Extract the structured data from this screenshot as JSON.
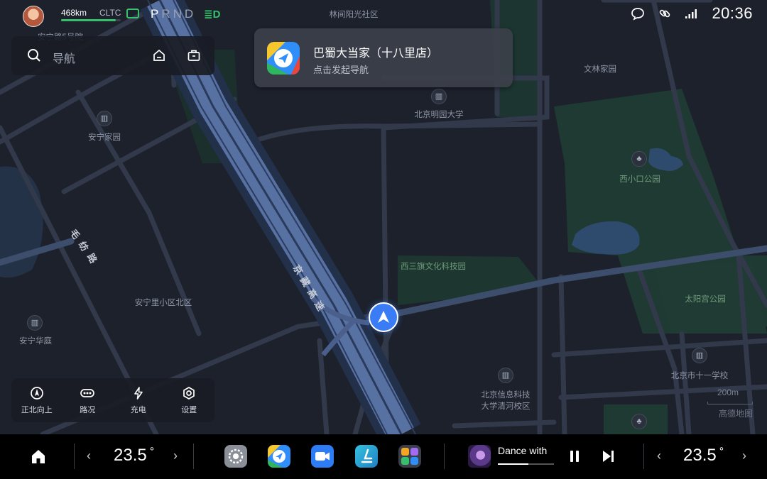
{
  "status": {
    "range": "468km",
    "range_standard": "CLTC",
    "range_level_percent": 92,
    "gear": {
      "letters": [
        "P",
        "R",
        "N",
        "D"
      ],
      "active": "P"
    },
    "headlight_icon": "≣D",
    "time": "20:36"
  },
  "search": {
    "placeholder": "导航"
  },
  "destination": {
    "name": "巴蜀大当家（十八里店）",
    "action": "点击发起导航"
  },
  "map": {
    "labels": [
      {
        "id": "a",
        "text": "林间阳光社区",
        "green": false
      },
      {
        "id": "b",
        "text": "安宁路5号院",
        "green": false
      },
      {
        "id": "c",
        "text": "文林家园",
        "green": false
      },
      {
        "id": "d",
        "text": "北京明园大学",
        "green": false
      },
      {
        "id": "e",
        "text": "安宁家园",
        "green": false
      },
      {
        "id": "f",
        "text": "西小口公园",
        "green": true
      },
      {
        "id": "g",
        "text": "西三旗文化科技园",
        "green": true
      },
      {
        "id": "h",
        "text": "太阳宫公园",
        "green": true
      },
      {
        "id": "i",
        "text": "安宁里小区北区",
        "green": false
      },
      {
        "id": "j",
        "text": "安宁华庭",
        "green": false
      },
      {
        "id": "k",
        "text": "北京市十一学校",
        "green": false
      },
      {
        "id": "l",
        "text": "北京信息科技",
        "green": false
      },
      {
        "id": "m",
        "text": "大学清河校区",
        "green": false
      }
    ],
    "road_names": [
      {
        "id": "r1",
        "chars": [
          "毛",
          "纺",
          "路"
        ]
      },
      {
        "id": "r2",
        "chars": [
          "京",
          "藏",
          "高",
          "速"
        ]
      }
    ],
    "scale": "200m",
    "provider": "高德地图"
  },
  "quick_actions": [
    {
      "icon": "compass-icon",
      "label": "正北向上"
    },
    {
      "icon": "traffic-icon",
      "label": "路况"
    },
    {
      "icon": "charge-icon",
      "label": "充电"
    },
    {
      "icon": "settings-icon",
      "label": "设置"
    }
  ],
  "dock": {
    "left_temp": "23.5",
    "right_temp": "23.5",
    "degree": "°",
    "song": "Dance with",
    "song_progress_percent": 55
  },
  "colors": {
    "accent": "#3a7cf5",
    "battery": "#34c06c",
    "park": "#1f3a33"
  }
}
